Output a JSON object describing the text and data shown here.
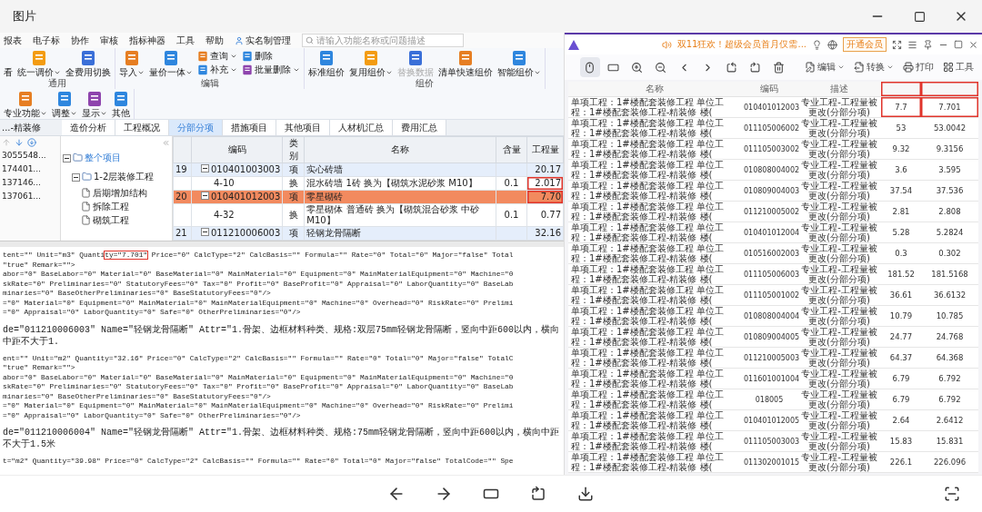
{
  "window": {
    "title": "图片"
  },
  "left_screenshot": {
    "menu": [
      {
        "kind": "label",
        "label": "报表"
      },
      {
        "kind": "label",
        "label": "电子标"
      },
      {
        "kind": "label",
        "label": "协作"
      },
      {
        "kind": "label",
        "label": "审核"
      },
      {
        "kind": "label",
        "label": "指标神器"
      },
      {
        "kind": "label",
        "label": "工具"
      },
      {
        "kind": "label",
        "label": "帮助"
      },
      {
        "kind": "icon_label",
        "label": "实名制管理"
      }
    ],
    "search": {
      "placeholder": "请输入功能名称或问题描述"
    },
    "ribbon": [
      {
        "label": "通用",
        "items": [
          {
            "kind": "label",
            "label": "看"
          },
          {
            "kind": "large",
            "label": "统一调价",
            "dropdown": true,
            "disabled": false
          },
          {
            "kind": "large",
            "label": "全费用切换",
            "dropdown": false,
            "disabled": false
          }
        ]
      },
      {
        "label": "编辑",
        "items": [
          {
            "kind": "large",
            "label": "导入",
            "dropdown": true,
            "disabled": false
          },
          {
            "kind": "large",
            "label": "量价一体",
            "dropdown": true,
            "disabled": false
          },
          {
            "kind": "stack",
            "items": [
              {
                "label": "查询",
                "dropdown": true,
                "disabled": false
              },
              {
                "label": "补充",
                "dropdown": true,
                "disabled": false
              }
            ]
          },
          {
            "kind": "stack",
            "items": [
              {
                "label": "删除",
                "dropdown": false,
                "disabled": false
              },
              {
                "label": "批量删除",
                "dropdown": true,
                "disabled": false
              }
            ]
          }
        ]
      },
      {
        "label": "组价",
        "items": [
          {
            "kind": "large",
            "label": "标准组价",
            "dropdown": false,
            "disabled": false
          },
          {
            "kind": "large",
            "label": "复用组价",
            "dropdown": true,
            "disabled": false
          },
          {
            "kind": "large",
            "label": "替换数据",
            "dropdown": false,
            "disabled": true
          },
          {
            "kind": "large",
            "label": "清单快速组价",
            "dropdown": false,
            "disabled": false
          },
          {
            "kind": "large",
            "label": "智能组价",
            "dropdown": true,
            "disabled": false
          }
        ]
      },
      {
        "items": [
          {
            "kind": "large",
            "label": "专业功能",
            "dropdown": true,
            "disabled": false
          },
          {
            "kind": "large",
            "label": "调整",
            "dropdown": true,
            "disabled": false
          },
          {
            "kind": "large",
            "label": "显示",
            "dropdown": true,
            "disabled": false
          },
          {
            "kind": "large",
            "label": "其他",
            "dropdown": false,
            "disabled": false
          }
        ]
      }
    ],
    "project_title": "...-精装修",
    "tabs": [
      {
        "label": "造价分析",
        "selected": false
      },
      {
        "label": "工程概况",
        "selected": false
      },
      {
        "label": "分部分项",
        "selected": true
      },
      {
        "label": "措施项目",
        "selected": false
      },
      {
        "label": "其他项目",
        "selected": false
      },
      {
        "label": "人材机汇总",
        "selected": false
      },
      {
        "label": "费用汇总",
        "selected": false
      }
    ],
    "numbers": [
      "3055548...",
      "174401...",
      "137146...",
      "137061..."
    ],
    "tree": [
      {
        "label": "整个项目",
        "selected": true,
        "expanded": true,
        "children": [
          {
            "label": "1-2层装修工程",
            "selected": false,
            "expanded": true,
            "children": [
              {
                "label": "后期增加结构",
                "selected": false
              },
              {
                "label": "拆除工程",
                "selected": false
              },
              {
                "label": "砌筑工程",
                "selected": false
              }
            ]
          }
        ]
      }
    ],
    "grid": {
      "columns": [
        "编码",
        "类别",
        "名称",
        "含量",
        "工程量"
      ],
      "rows": [
        {
          "number": "19",
          "kind": "item",
          "expanded": true,
          "code": "010401003003",
          "type": "项",
          "name": "实心砖墙",
          "qty": "20.17",
          "selected": false,
          "boxed": false
        },
        {
          "kind": "sub",
          "code": "4-10",
          "type": "换",
          "name": "混水砖墙 1砖 换为【砌筑水泥砂浆 M10】",
          "content": "0.1",
          "qty": "2.017",
          "selected": false,
          "boxed": true
        },
        {
          "number": "20",
          "kind": "item",
          "expanded": true,
          "code": "010401012003",
          "type": "项",
          "name": "零星砌砖",
          "qty": "7.70",
          "selected": true,
          "boxed": true
        },
        {
          "kind": "sub",
          "code": "4-32",
          "type": "换",
          "name": "零星砌体 普通砖 换为【砌筑混合砂浆 中砂 M10】",
          "content": "0.1",
          "qty": "0.77",
          "selected": false,
          "boxed": false
        },
        {
          "number": "21",
          "kind": "item",
          "expanded": true,
          "code": "011210006003",
          "type": "项",
          "name": "轻钢龙骨隔断",
          "qty": "32.16",
          "selected": false,
          "boxed": false
        }
      ]
    },
    "xml_lines": [
      {
        "kind": "boxed",
        "before": "tent=\"\" Unit=\"m3\" Quanti",
        "boxed": "ty=\"7.701\"",
        "after": " Price=\"0\" CalcType=\"2\" CalcBasis=\"\" Formula=\"\" Rate=\"0\" Total=\"0\" Major=\"false\" Total"
      },
      {
        "kind": "code",
        "text": "\"true\" Remark=\"\">"
      },
      {
        "kind": "code",
        "text": "abor=\"0\" BaseLabor=\"0\" Material=\"0\" BaseMaterial=\"0\" MainMaterial=\"0\" Equipment=\"0\" MainMaterialEquipment=\"0\" Machine=\"0"
      },
      {
        "kind": "code",
        "text": "skRate=\"0\" Preliminaries=\"0\" StatutoryFees=\"0\" Tax=\"0\" Profit=\"0\" BaseProfit=\"0\" Appraisal=\"0\" LaborQuantity=\"0\" BaseLab"
      },
      {
        "kind": "code",
        "text": "minaries=\"0\" BaseOtherPreliminaries=\"0\" BaseStatutoryFees=\"0\"/>"
      },
      {
        "kind": "code",
        "text": "=\"0\" Material=\"0\" Equipment=\"0\" MainMaterial=\"0\" MainMaterialEquipment=\"0\" Machine=\"0\" Overhead=\"0\" RiskRate=\"0\" Prelimi"
      },
      {
        "kind": "code",
        "text": "=\"0\" Appraisal=\"0\" LaborQuantity=\"0\" Safe=\"0\" OtherPreliminaries=\"0\"/>"
      },
      {
        "kind": "gap"
      },
      {
        "kind": "attr",
        "text": "de=\"011210006003\" Name=\"轻钢龙骨隔断\" Attr=\"1.骨架、边框材料种类、规格:双层75mm轻钢龙骨隔断，竖向中距600以内，横向中距不大于1."
      },
      {
        "kind": "gap"
      },
      {
        "kind": "code",
        "text": "ent=\"\" Unit=\"m2\" Quantity=\"32.16\" Price=\"0\" CalcType=\"2\" CalcBasis=\"\" Formula=\"\" Rate=\"0\" Total=\"0\" Major=\"false\" TotalC"
      },
      {
        "kind": "code",
        "text": "\"true\" Remark=\"\">"
      },
      {
        "kind": "code",
        "text": "abor=\"0\" BaseLabor=\"0\" Material=\"0\" BaseMaterial=\"0\" MainMaterial=\"0\" Equipment=\"0\" MainMaterialEquipment=\"0\" Machine=\"0"
      },
      {
        "kind": "code",
        "text": "skRate=\"0\" Preliminaries=\"0\" StatutoryFees=\"0\" Tax=\"0\" Profit=\"0\" BaseProfit=\"0\" Appraisal=\"0\" LaborQuantity=\"0\" BaseLab"
      },
      {
        "kind": "code",
        "text": "minaries=\"0\" BaseOtherPreliminaries=\"0\" BaseStatutoryFees=\"0\"/>"
      },
      {
        "kind": "code",
        "text": "=\"0\" Material=\"0\" Equipment=\"0\" MainMaterial=\"0\" MainMaterialEquipment=\"0\" Machine=\"0\" Overhead=\"0\" RiskRate=\"0\" Prelimi"
      },
      {
        "kind": "code",
        "text": "=\"0\" Appraisal=\"0\" LaborQuantity=\"0\" Safe=\"0\" OtherPreliminaries=\"0\"/>"
      },
      {
        "kind": "gap"
      },
      {
        "kind": "attr",
        "text": "de=\"011210006004\" Name=\"轻钢龙骨隔断\" Attr=\"1.骨架、边框材料种类、规格:75mm轻钢龙骨隔断，竖向中距600以内，横向中距不大于1.5米"
      },
      {
        "kind": "gap"
      },
      {
        "kind": "code",
        "text": "t=\"m2\" Quantity=\"39.98\" Price=\"0\" CalcType=\"2\" CalcBasis=\"\" Formula=\"\" Rate=\"0\" Total=\"0\" Major=\"false\" TotalCode=\"\" Spe"
      }
    ]
  },
  "viewer": {
    "promo": "双11狂欢！超级会员首月仅需...",
    "vip_button": "开通会员",
    "toolbar": [
      {
        "kind": "mouse",
        "selected": true
      },
      {
        "kind": "ratio",
        "selected": false
      },
      {
        "kind": "zoom_in",
        "selected": false
      },
      {
        "kind": "zoom_out",
        "selected": false
      },
      {
        "kind": "prev",
        "selected": false
      },
      {
        "kind": "next",
        "selected": false
      },
      {
        "kind": "rotate_left",
        "selected": false
      },
      {
        "kind": "rotate_right",
        "selected": false
      },
      {
        "kind": "delete",
        "selected": false
      }
    ],
    "actions": [
      {
        "kind": "edit",
        "label": "编辑",
        "dropdown": true
      },
      {
        "kind": "convert",
        "label": "转换",
        "dropdown": true
      },
      {
        "kind": "print",
        "label": "打印",
        "dropdown": false
      },
      {
        "kind": "tools",
        "label": "工具",
        "dropdown": false
      }
    ],
    "table": {
      "columns": [
        {
          "label": "名称",
          "boxed": false
        },
        {
          "label": "编码",
          "boxed": false
        },
        {
          "label": "描述",
          "boxed": false
        },
        {
          "boxed": true
        },
        {
          "boxed": true
        }
      ],
      "rows": [
        {
          "name": "单项工程：1#楼配套装修工程 单位工程：1#楼配套装修工程-精装修 楼(",
          "code": "010401012003",
          "desc": "专业工程-工程量被更改(分部分项)",
          "value_1": "7.7",
          "value_2": "7.701",
          "boxed": true
        },
        {
          "name": "单项工程：1#楼配套装修工程 单位工程：1#楼配套装修工程-精装修 楼(",
          "code": "011105006002",
          "desc": "专业工程-工程量被更改(分部分项)",
          "value_1": "53",
          "value_2": "53.0042",
          "boxed": false
        },
        {
          "name": "单项工程：1#楼配套装修工程 单位工程：1#楼配套装修工程-精装修 楼(",
          "code": "011105003002",
          "desc": "专业工程-工程量被更改(分部分项)",
          "value_1": "9.32",
          "value_2": "9.3156",
          "boxed": false
        },
        {
          "name": "单项工程：1#楼配套装修工程 单位工程：1#楼配套装修工程-精装修 楼(",
          "code": "010808004002",
          "desc": "专业工程-工程量被更改(分部分项)",
          "value_1": "3.6",
          "value_2": "3.595",
          "boxed": false
        },
        {
          "name": "单项工程：1#楼配套装修工程 单位工程：1#楼配套装修工程-精装修 楼(",
          "code": "010809004003",
          "desc": "专业工程-工程量被更改(分部分项)",
          "value_1": "37.54",
          "value_2": "37.536",
          "boxed": false
        },
        {
          "name": "单项工程：1#楼配套装修工程 单位工程：1#楼配套装修工程-精装修 楼(",
          "code": "011210005002",
          "desc": "专业工程-工程量被更改(分部分项)",
          "value_1": "2.81",
          "value_2": "2.808",
          "boxed": false
        },
        {
          "name": "单项工程：1#楼配套装修工程 单位工程：1#楼配套装修工程-精装修 楼(",
          "code": "010401012004",
          "desc": "专业工程-工程量被更改(分部分项)",
          "value_1": "5.28",
          "value_2": "5.2824",
          "boxed": false
        },
        {
          "name": "单项工程：1#楼配套装修工程 单位工程：1#楼配套装修工程-精装修 楼(",
          "code": "010516002003",
          "desc": "专业工程-工程量被更改(分部分项)",
          "value_1": "0.3",
          "value_2": "0.302",
          "boxed": false
        },
        {
          "name": "单项工程：1#楼配套装修工程 单位工程：1#楼配套装修工程-精装修 楼(",
          "code": "011105006003",
          "desc": "专业工程-工程量被更改(分部分项)",
          "value_1": "181.52",
          "value_2": "181.5168",
          "boxed": false
        },
        {
          "name": "单项工程：1#楼配套装修工程 单位工程：1#楼配套装修工程-精装修 楼(",
          "code": "011105001002",
          "desc": "专业工程-工程量被更改(分部分项)",
          "value_1": "36.61",
          "value_2": "36.6132",
          "boxed": false
        },
        {
          "name": "单项工程：1#楼配套装修工程 单位工程：1#楼配套装修工程-精装修 楼(",
          "code": "010808004004",
          "desc": "专业工程-工程量被更改(分部分项)",
          "value_1": "10.79",
          "value_2": "10.785",
          "boxed": false
        },
        {
          "name": "单项工程：1#楼配套装修工程 单位工程：1#楼配套装修工程-精装修 楼(",
          "code": "010809004005",
          "desc": "专业工程-工程量被更改(分部分项)",
          "value_1": "24.77",
          "value_2": "24.768",
          "boxed": false
        },
        {
          "name": "单项工程：1#楼配套装修工程 单位工程：1#楼配套装修工程-精装修 楼(",
          "code": "011210005003",
          "desc": "专业工程-工程量被更改(分部分项)",
          "value_1": "64.37",
          "value_2": "64.368",
          "boxed": false
        },
        {
          "name": "单项工程：1#楼配套装修工程 单位工程：1#楼配套装修工程-精装修 楼(",
          "code": "011601001004",
          "desc": "专业工程-工程量被更改(分部分项)",
          "value_1": "6.79",
          "value_2": "6.792",
          "boxed": false
        },
        {
          "name": "单项工程：1#楼配套装修工程 单位工程：1#楼配套装修工程-精装修 楼(",
          "code": "018005",
          "desc": "专业工程-工程量被更改(分部分项)",
          "value_1": "6.79",
          "value_2": "6.792",
          "boxed": false
        },
        {
          "name": "单项工程：1#楼配套装修工程 单位工程：1#楼配套装修工程-精装修 楼(",
          "code": "010401012005",
          "desc": "专业工程-工程量被更改(分部分项)",
          "value_1": "2.64",
          "value_2": "2.6412",
          "boxed": false
        },
        {
          "name": "单项工程：1#楼配套装修工程 单位工程：1#楼配套装修工程-精装修 楼(",
          "code": "011105003003",
          "desc": "专业工程-工程量被更改(分部分项)",
          "value_1": "15.83",
          "value_2": "15.831",
          "boxed": false
        },
        {
          "name": "单项工程：1#楼配套装修工程 单位工程：1#楼配套装修工程-精装修 楼(",
          "code": "011302001015",
          "desc": "专业工程-工程量被更改(分部分项)",
          "value_1": "226.1",
          "value_2": "226.096",
          "boxed": false
        }
      ]
    }
  }
}
